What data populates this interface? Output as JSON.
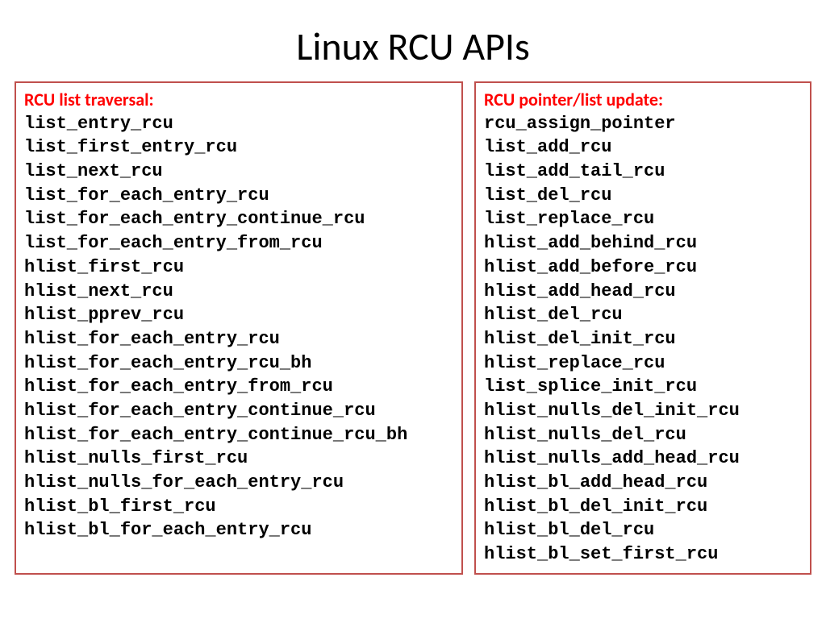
{
  "title": "Linux RCU APIs",
  "left": {
    "header": "RCU list traversal:",
    "items": [
      "list_entry_rcu",
      "list_first_entry_rcu",
      "list_next_rcu",
      "list_for_each_entry_rcu",
      "list_for_each_entry_continue_rcu",
      "list_for_each_entry_from_rcu",
      "hlist_first_rcu",
      "hlist_next_rcu",
      "hlist_pprev_rcu",
      "hlist_for_each_entry_rcu",
      "hlist_for_each_entry_rcu_bh",
      "hlist_for_each_entry_from_rcu",
      "hlist_for_each_entry_continue_rcu",
      "hlist_for_each_entry_continue_rcu_bh",
      "hlist_nulls_first_rcu",
      "hlist_nulls_for_each_entry_rcu",
      "hlist_bl_first_rcu",
      "hlist_bl_for_each_entry_rcu"
    ]
  },
  "right": {
    "header": "RCU pointer/list update:",
    "items": [
      "rcu_assign_pointer",
      "list_add_rcu",
      "list_add_tail_rcu",
      "list_del_rcu",
      "list_replace_rcu",
      "hlist_add_behind_rcu",
      "hlist_add_before_rcu",
      "hlist_add_head_rcu",
      "hlist_del_rcu",
      "hlist_del_init_rcu",
      "hlist_replace_rcu",
      "list_splice_init_rcu",
      "hlist_nulls_del_init_rcu",
      "hlist_nulls_del_rcu",
      "hlist_nulls_add_head_rcu",
      "hlist_bl_add_head_rcu",
      "hlist_bl_del_init_rcu",
      "hlist_bl_del_rcu",
      "hlist_bl_set_first_rcu"
    ]
  }
}
